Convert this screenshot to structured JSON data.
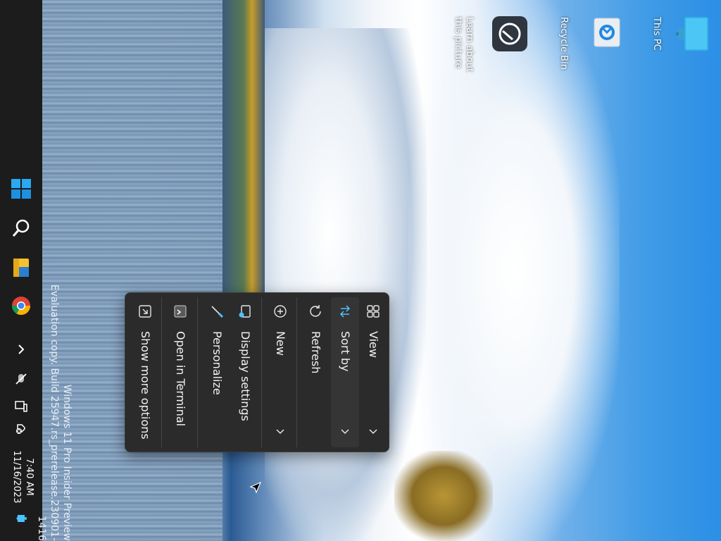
{
  "desktop": {
    "icons": [
      {
        "name": "this-pc",
        "label": "This PC"
      },
      {
        "name": "recycle-bin",
        "label": "Recycle Bin"
      },
      {
        "name": "learn-about-picture",
        "label": "Learn about\nthis picture"
      }
    ],
    "watermark": {
      "line1": "Windows 11 Pro Insider Preview",
      "line2": "Evaluation copy. Build 25947.rs_prerelease.230901-1416"
    }
  },
  "context_menu": {
    "items": [
      {
        "label": "View",
        "icon": "grid-icon",
        "has_submenu": true
      },
      {
        "label": "Sort by",
        "icon": "sort-arrows-icon",
        "has_submenu": true
      },
      {
        "label": "Refresh",
        "icon": "refresh-icon",
        "has_submenu": false
      },
      {
        "label": "New",
        "icon": "plus-circle-icon",
        "has_submenu": true
      },
      {
        "label": "Display settings",
        "icon": "display-settings-icon",
        "has_submenu": false
      },
      {
        "label": "Personalize",
        "icon": "brush-icon",
        "has_submenu": false
      },
      {
        "label": "Open in Terminal",
        "icon": "terminal-icon",
        "has_submenu": false
      },
      {
        "label": "Show more options",
        "icon": "expand-icon",
        "has_submenu": false
      }
    ]
  },
  "taskbar": {
    "apps": [
      {
        "name": "start",
        "icon": "windows-logo-icon"
      },
      {
        "name": "search",
        "icon": "search-icon"
      },
      {
        "name": "file-explorer",
        "icon": "folder-icon"
      },
      {
        "name": "chrome",
        "icon": "chrome-icon"
      }
    ],
    "tray": {
      "overflow_icon": "chevron-right-icon",
      "icons": [
        "microphone-muted-icon",
        "network-icon",
        "volume-muted-icon"
      ]
    },
    "clock": {
      "time": "7:40 AM",
      "date": "11/16/2023"
    },
    "notification_icon": "bell-icon"
  },
  "colors": {
    "taskbar": "#1c1c1c",
    "menu_bg": "#2b2b2b",
    "accent": "#4cc2ff"
  }
}
